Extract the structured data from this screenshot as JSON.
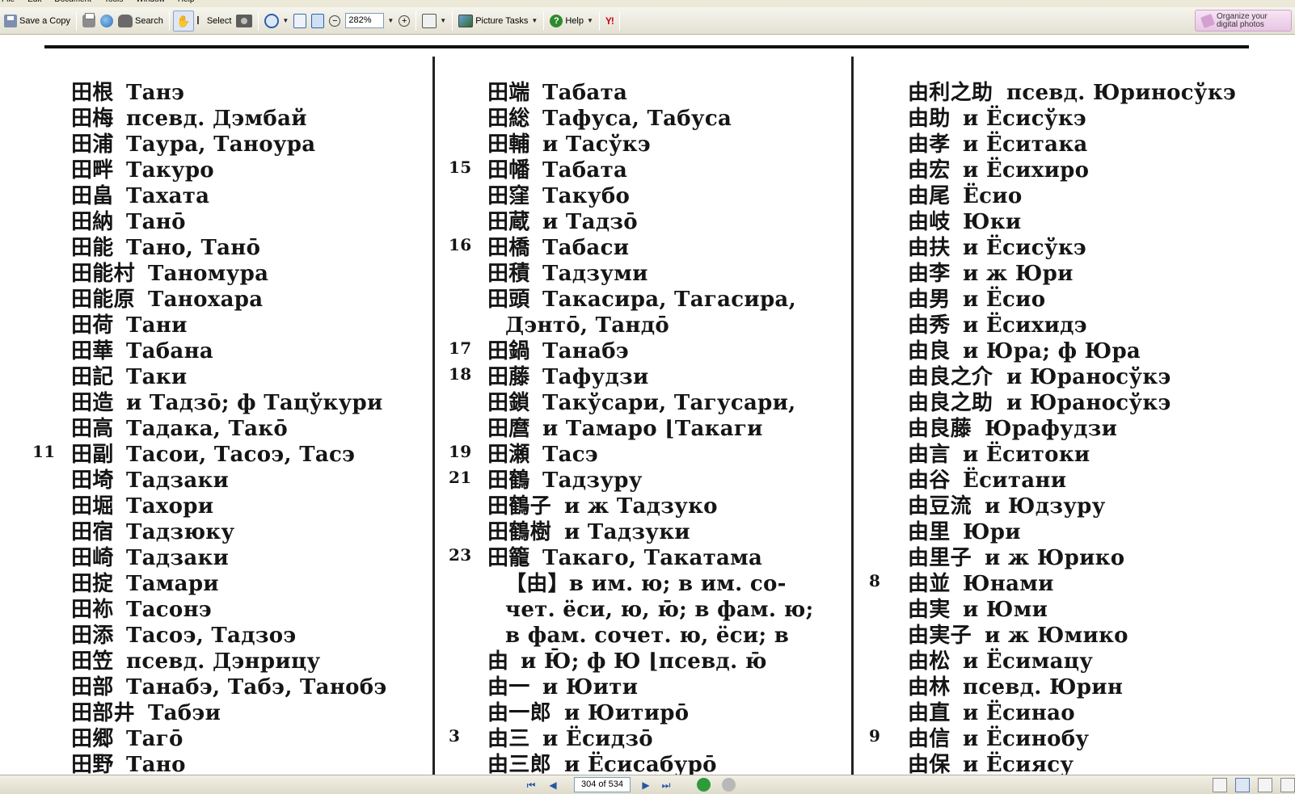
{
  "menubar": {
    "items": [
      "File",
      "Edit",
      "Document",
      "Tools",
      "Window",
      "Help"
    ]
  },
  "toolbar": {
    "save_copy_label": "Save a Copy",
    "search_label": "Search",
    "select_label": "Select",
    "zoom_value": "282%",
    "picture_tasks_label": "Picture Tasks",
    "help_label": "Help",
    "yahoo_label": "Y!",
    "organize_label_line1": "Organize your",
    "organize_label_line2": "digital photos"
  },
  "document": {
    "column1": [
      {
        "num": "",
        "kanji": "田根",
        "reading": "Танэ"
      },
      {
        "num": "",
        "kanji": "田梅",
        "reading": "псевд. Дэмбай"
      },
      {
        "num": "",
        "kanji": "田浦",
        "reading": "Таура, Таноура"
      },
      {
        "num": "",
        "kanji": "田畔",
        "reading": "Такуро"
      },
      {
        "num": "",
        "kanji": "田畠",
        "reading": "Тахата"
      },
      {
        "num": "",
        "kanji": "田納",
        "reading": "Танō"
      },
      {
        "num": "",
        "kanji": "田能",
        "reading": "Тано, Танō"
      },
      {
        "num": "",
        "kanji": "田能村",
        "reading": "Таномура"
      },
      {
        "num": "",
        "kanji": "田能原",
        "reading": "Танохара"
      },
      {
        "num": "",
        "kanji": "田荷",
        "reading": "Тани"
      },
      {
        "num": "",
        "kanji": "田華",
        "reading": "Табана"
      },
      {
        "num": "",
        "kanji": "田記",
        "reading": "Таки"
      },
      {
        "num": "",
        "kanji": "田造",
        "reading": "и Тадзō; ф Тацўкури"
      },
      {
        "num": "",
        "kanji": "田高",
        "reading": "Тадака, Такō"
      },
      {
        "num": "11",
        "kanji": "田副",
        "reading": "Тасои, Тасоэ, Тасэ"
      },
      {
        "num": "",
        "kanji": "田埼",
        "reading": "Тадзаки"
      },
      {
        "num": "",
        "kanji": "田堀",
        "reading": "Тахори"
      },
      {
        "num": "",
        "kanji": "田宿",
        "reading": "Тадзюку"
      },
      {
        "num": "",
        "kanji": "田崎",
        "reading": "Тадзаки"
      },
      {
        "num": "",
        "kanji": "田掟",
        "reading": "Тамари"
      },
      {
        "num": "",
        "kanji": "田袮",
        "reading": "Тасонэ"
      },
      {
        "num": "",
        "kanji": "田添",
        "reading": "Тасоэ, Тадзоэ"
      },
      {
        "num": "",
        "kanji": "田笠",
        "reading": "псевд. Дэнрицу"
      },
      {
        "num": "",
        "kanji": "田部",
        "reading": "Танабэ, Табэ, Танобэ"
      },
      {
        "num": "",
        "kanji": "田部井",
        "reading": "Табэи"
      },
      {
        "num": "",
        "kanji": "田郷",
        "reading": "Тагō"
      },
      {
        "num": "",
        "kanji": "田野",
        "reading": "Тано"
      }
    ],
    "column2": [
      {
        "num": "",
        "kanji": "田端",
        "reading": "Табата"
      },
      {
        "num": "",
        "kanji": "田総",
        "reading": "Тафуса, Табуса"
      },
      {
        "num": "",
        "kanji": "田輔",
        "reading": "и Тасўкэ"
      },
      {
        "num": "15",
        "kanji": "田幡",
        "reading": "Табата"
      },
      {
        "num": "",
        "kanji": "田窪",
        "reading": "Такубо"
      },
      {
        "num": "",
        "kanji": "田蔵",
        "reading": "и Тадзō"
      },
      {
        "num": "16",
        "kanji": "田橋",
        "reading": "Табаси"
      },
      {
        "num": "",
        "kanji": "田積",
        "reading": "Тадзуми"
      },
      {
        "num": "",
        "kanji": "田頭",
        "reading": "Такасира, Тагасира,"
      },
      {
        "num": "",
        "kanji": "",
        "reading": "Дэнтō, Тандō"
      },
      {
        "num": "17",
        "kanji": "田鍋",
        "reading": "Танабэ"
      },
      {
        "num": "18",
        "kanji": "田藤",
        "reading": "Тафудзи"
      },
      {
        "num": "",
        "kanji": "田鎖",
        "reading": "Такўсари, Тагусари,"
      },
      {
        "num": "",
        "kanji": "田麿",
        "reading": "и Тамаро ⌊Такаги"
      },
      {
        "num": "19",
        "kanji": "田瀬",
        "reading": "Тасэ"
      },
      {
        "num": "21",
        "kanji": "田鶴",
        "reading": "Тадзуру"
      },
      {
        "num": "",
        "kanji": "田鶴子",
        "reading": "и ж Тадзуко"
      },
      {
        "num": "",
        "kanji": "田鶴樹",
        "reading": "и Тадзуки"
      },
      {
        "num": "23",
        "kanji": "田籠",
        "reading": "Такаго, Такатама"
      },
      {
        "num": "",
        "kanji": "",
        "reading": "【由】в им. ю; в им. со-"
      },
      {
        "num": "",
        "kanji": "",
        "reading": "чет. ёси, ю, ю̄; в фам. ю;"
      },
      {
        "num": "",
        "kanji": "",
        "reading": "в фам. сочет. ю, ёси; в"
      },
      {
        "num": "",
        "kanji": "由",
        "reading": "и Ю̄; ф Ю ⌊псевд. ю̄"
      },
      {
        "num": "",
        "kanji": "由一",
        "reading": "и Юити"
      },
      {
        "num": "",
        "kanji": "由一郎",
        "reading": "и Юитирō"
      },
      {
        "num": "3",
        "kanji": "由三",
        "reading": "и Ёсидзō"
      },
      {
        "num": "",
        "kanji": "由三郎",
        "reading": "и Ёсисабурō"
      }
    ],
    "column3": [
      {
        "num": "",
        "kanji": "由利之助",
        "reading": "псевд. Юриносўкэ"
      },
      {
        "num": "",
        "kanji": "由助",
        "reading": "и Ёсисўкэ"
      },
      {
        "num": "",
        "kanji": "由孝",
        "reading": "и Ёситака"
      },
      {
        "num": "",
        "kanji": "由宏",
        "reading": "и Ёсихиро"
      },
      {
        "num": "",
        "kanji": "由尾",
        "reading": "Ёсио"
      },
      {
        "num": "",
        "kanji": "由岐",
        "reading": "Юки"
      },
      {
        "num": "",
        "kanji": "由扶",
        "reading": "и Ёсисўкэ"
      },
      {
        "num": "",
        "kanji": "由李",
        "reading": "и ж Юри"
      },
      {
        "num": "",
        "kanji": "由男",
        "reading": "и Ёсио"
      },
      {
        "num": "",
        "kanji": "由秀",
        "reading": "и Ёсихидэ"
      },
      {
        "num": "",
        "kanji": "由良",
        "reading": "и Юра; ф Юра"
      },
      {
        "num": "",
        "kanji": "由良之介",
        "reading": "и Юраносўкэ"
      },
      {
        "num": "",
        "kanji": "由良之助",
        "reading": "и Юраносўкэ"
      },
      {
        "num": "",
        "kanji": "由良藤",
        "reading": "Юрафудзи"
      },
      {
        "num": "",
        "kanji": "由言",
        "reading": "и Ёситоки"
      },
      {
        "num": "",
        "kanji": "由谷",
        "reading": "Ёситани"
      },
      {
        "num": "",
        "kanji": "由豆流",
        "reading": "и Юдзуру"
      },
      {
        "num": "",
        "kanji": "由里",
        "reading": "Юри"
      },
      {
        "num": "",
        "kanji": "由里子",
        "reading": "и ж Юрико"
      },
      {
        "num": "8",
        "kanji": "由並",
        "reading": "Юнами"
      },
      {
        "num": "",
        "kanji": "由実",
        "reading": "и Юми"
      },
      {
        "num": "",
        "kanji": "由実子",
        "reading": "и ж Юмико"
      },
      {
        "num": "",
        "kanji": "由松",
        "reading": "и Ёсимацу"
      },
      {
        "num": "",
        "kanji": "由林",
        "reading": "псевд. Юрин"
      },
      {
        "num": "",
        "kanji": "由直",
        "reading": "и Ёсинао"
      },
      {
        "num": "9",
        "kanji": "由信",
        "reading": "и Ёсинобу"
      },
      {
        "num": "",
        "kanji": "由保",
        "reading": "и Ёсиясу"
      }
    ]
  },
  "statusbar": {
    "page_indicator": "304 of 534"
  }
}
